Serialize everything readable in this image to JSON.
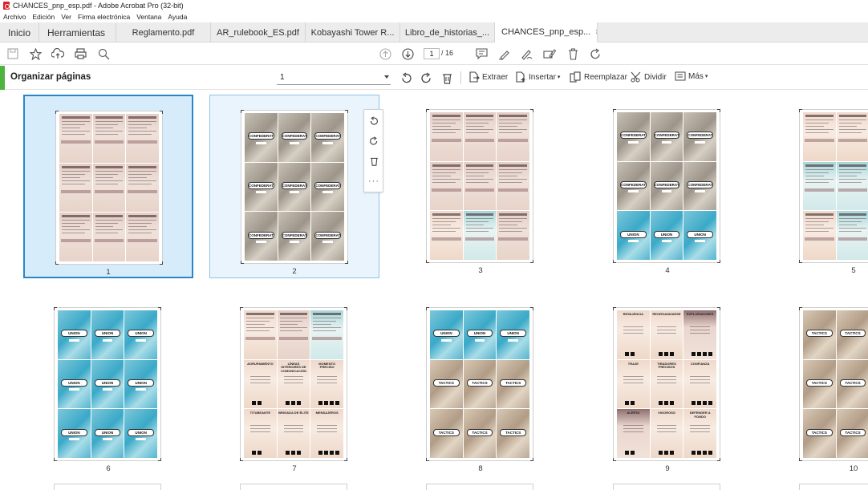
{
  "window": {
    "title": "CHANCES_pnp_esp.pdf - Adobe Acrobat Pro (32-bit)"
  },
  "menu": [
    "Archivo",
    "Edición",
    "Ver",
    "Firma electrónica",
    "Ventana",
    "Ayuda"
  ],
  "tabs": {
    "home": "Inicio",
    "tools": "Herramientas",
    "docs": [
      "Reglamento.pdf",
      "AR_rulebook_ES.pdf",
      "Kobayashi Tower R...",
      "Libro_de_historias_..."
    ],
    "active": "CHANCES_pnp_esp...",
    "close_glyph": "×"
  },
  "toolbar": {
    "current_page": "1",
    "total_pages": "/ 16"
  },
  "organize": {
    "title": "Organizar páginas",
    "page_select_value": "1",
    "extract": "Extraer",
    "insert": "Insertar",
    "replace": "Reemplazar",
    "split": "Dividir",
    "more": "Más"
  },
  "card_labels": {
    "confederate": "CONFEDERATE",
    "union": "UNION",
    "tactics": "TACTICS"
  },
  "pages": [
    {
      "number": "1",
      "state": "selected",
      "layout": "text-rose"
    },
    {
      "number": "2",
      "state": "hover",
      "layout": "confederate"
    },
    {
      "number": "3",
      "state": "normal",
      "layout": "text-mixed"
    },
    {
      "number": "4",
      "state": "normal",
      "layout": "confed-union"
    },
    {
      "number": "5",
      "state": "normal",
      "layout": "text-teal"
    },
    {
      "number": "6",
      "state": "normal",
      "layout": "union"
    },
    {
      "number": "7",
      "state": "normal",
      "layout": "mixed-text"
    },
    {
      "number": "8",
      "state": "normal",
      "layout": "union-tactics"
    },
    {
      "number": "9",
      "state": "normal",
      "layout": "big-text"
    },
    {
      "number": "10",
      "state": "normal",
      "layout": "tactics"
    }
  ],
  "big_text_titles": {
    "p7": [
      "AGRUPAMIENTO",
      "LÍNEAS INTERIORES DE COMUNICACIÓN",
      "MOMENTO PRECISO",
      "TITUBEANTE",
      "BRIGADA DE ÉLITE",
      "MENSAJEROS"
    ],
    "p9": [
      "RESILIENCIA",
      "REORGANIZARSE",
      "EXPLORADORES",
      "TRAJE",
      "TIRADORES PRECISOS",
      "CONFIANZA",
      "ALERTA",
      "VIGOROSO",
      "DEFENDER A FONDO"
    ]
  }
}
